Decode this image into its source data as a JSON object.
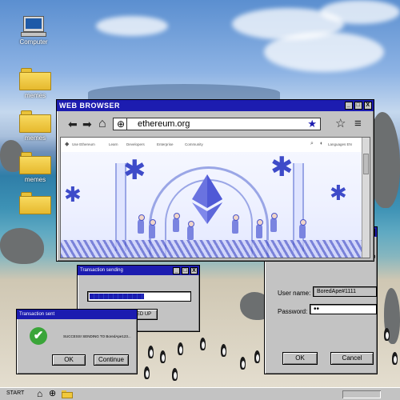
{
  "desktop": {
    "icons": [
      {
        "label": "Computer",
        "icon": "computer-icon"
      },
      {
        "label": "memes",
        "icon": "folder-icon"
      },
      {
        "label": "memes",
        "icon": "folder-icon"
      },
      {
        "label": "memes",
        "icon": "folder-icon"
      },
      {
        "label": "",
        "icon": "folder-icon"
      }
    ]
  },
  "browser": {
    "title": "WEB BROWSER",
    "window_buttons": {
      "minimize": "_",
      "maximize": "□",
      "close": "X"
    },
    "back_glyph": "⬅",
    "forward_glyph": "➡",
    "home_glyph": "⌂",
    "url": "ethereum.org",
    "bookmark_glyph": "★",
    "star_outline_glyph": "☆",
    "menu_glyph": "≡",
    "site_nav": {
      "logo_glyph": "◆",
      "items": [
        "Use Ethereum",
        "Learn",
        "Developers",
        "Enterprise",
        "Community"
      ],
      "search_glyph": "⌕",
      "theme_glyph": "◐",
      "language": "Languages EN"
    },
    "accent_color": "#1c1cb0"
  },
  "tx_sending": {
    "title": "Transaction sending",
    "progress": 0.55,
    "speed_up_label": "SPEED UP"
  },
  "tx_sent": {
    "title": "Transaction sent",
    "message": "SUCCESS! SENDING TO BoredApe123...",
    "ok_label": "OK",
    "continue_label": "Continue",
    "success_color": "#3aa539"
  },
  "login": {
    "title_help": "?",
    "title_close": "X",
    "cut_text": "o",
    "username_label": "User name:",
    "username_value": "BoredApe#1111",
    "password_label": "Password:",
    "password_value": "••",
    "ok_label": "OK",
    "cancel_label": "Cancel"
  },
  "taskbar": {
    "start_label": "START",
    "home_glyph": "⌂",
    "globe_glyph": "⊕"
  }
}
